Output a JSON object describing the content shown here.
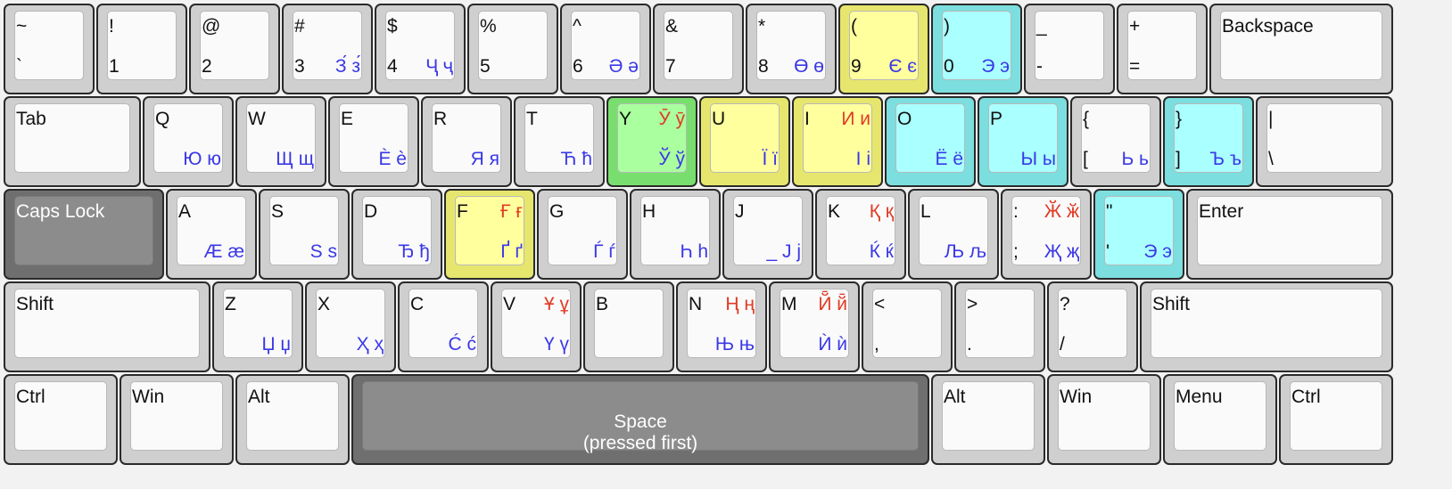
{
  "keys": [
    {
      "row": 0,
      "w": 1,
      "tl": "~",
      "bl": "`"
    },
    {
      "row": 0,
      "w": 1,
      "tl": "!",
      "bl": "1"
    },
    {
      "row": 0,
      "w": 1,
      "tl": "@",
      "bl": "2"
    },
    {
      "row": 0,
      "w": 1,
      "tl": "#",
      "bl": "3",
      "br": "З́ з́"
    },
    {
      "row": 0,
      "w": 1,
      "tl": "$",
      "bl": "4",
      "br": "Ҷ ҷ"
    },
    {
      "row": 0,
      "w": 1,
      "tl": "%",
      "bl": "5"
    },
    {
      "row": 0,
      "w": 1,
      "tl": "^",
      "bl": "6",
      "br": "Ә ә"
    },
    {
      "row": 0,
      "w": 1,
      "tl": "&",
      "bl": "7"
    },
    {
      "row": 0,
      "w": 1,
      "tl": "*",
      "bl": "8",
      "br": "Ө ө"
    },
    {
      "row": 0,
      "w": 1,
      "tl": "(",
      "bl": "9",
      "br": "Є є",
      "color": "yellow"
    },
    {
      "row": 0,
      "w": 1,
      "tl": ")",
      "bl": "0",
      "br": "Э э",
      "color": "cyan"
    },
    {
      "row": 0,
      "w": 1,
      "tl": "_",
      "bl": "-"
    },
    {
      "row": 0,
      "w": 1,
      "tl": "+",
      "bl": "="
    },
    {
      "row": 0,
      "w": 2,
      "tl": "Backspace"
    },
    {
      "row": 1,
      "w": 1.5,
      "tl": "Tab"
    },
    {
      "row": 1,
      "w": 1,
      "tl": "Q",
      "br": "Ю ю"
    },
    {
      "row": 1,
      "w": 1,
      "tl": "W",
      "br": "Щ щ"
    },
    {
      "row": 1,
      "w": 1,
      "tl": "E",
      "br": "È è"
    },
    {
      "row": 1,
      "w": 1,
      "tl": "R",
      "br": "Я я"
    },
    {
      "row": 1,
      "w": 1,
      "tl": "T",
      "br": "Ћ ћ"
    },
    {
      "row": 1,
      "w": 1,
      "tl": "Y",
      "tr": "Ӯ ӯ",
      "br": "Ў ў",
      "color": "green"
    },
    {
      "row": 1,
      "w": 1,
      "tl": "U",
      "br": "Ї ї",
      "color": "yellow"
    },
    {
      "row": 1,
      "w": 1,
      "tl": "I",
      "tr": "И и",
      "br": "І і",
      "color": "yellow"
    },
    {
      "row": 1,
      "w": 1,
      "tl": "O",
      "br": "Ё ё",
      "color": "cyan"
    },
    {
      "row": 1,
      "w": 1,
      "tl": "P",
      "br": "Ы ы",
      "color": "cyan"
    },
    {
      "row": 1,
      "w": 1,
      "tl": "{",
      "bl": "[",
      "br": "Ь ь"
    },
    {
      "row": 1,
      "w": 1,
      "tl": "}",
      "bl": "]",
      "br": "Ъ ъ",
      "color": "cyan"
    },
    {
      "row": 1,
      "w": 1.5,
      "tl": "|",
      "bl": "\\"
    },
    {
      "row": 2,
      "w": 1.75,
      "tl": "Caps Lock",
      "color": "dark"
    },
    {
      "row": 2,
      "w": 1,
      "tl": "A",
      "br": "Æ æ"
    },
    {
      "row": 2,
      "w": 1,
      "tl": "S",
      "br": "Ѕ ѕ"
    },
    {
      "row": 2,
      "w": 1,
      "tl": "D",
      "br": "Ђ ђ"
    },
    {
      "row": 2,
      "w": 1,
      "tl": "F",
      "tr": "Ғ ғ",
      "br": "Ґ ґ",
      "color": "yellow"
    },
    {
      "row": 2,
      "w": 1,
      "tl": "G",
      "br": "Ѓ ѓ"
    },
    {
      "row": 2,
      "w": 1,
      "tl": "H",
      "br": "Һ һ"
    },
    {
      "row": 2,
      "w": 1,
      "tl": "J",
      "br": "_ Ј ј"
    },
    {
      "row": 2,
      "w": 1,
      "tl": "K",
      "tr": "Қ қ",
      "br": "Ќ ќ"
    },
    {
      "row": 2,
      "w": 1,
      "tl": "L",
      "br": "Љ љ"
    },
    {
      "row": 2,
      "w": 1,
      "tl": ":",
      "bl": ";",
      "tr": "Ӂ ӂ",
      "br": "Җ җ"
    },
    {
      "row": 2,
      "w": 1,
      "tl": "\"",
      "bl": "'",
      "br": "Э э",
      "color": "cyan"
    },
    {
      "row": 2,
      "w": 2.25,
      "tl": "Enter"
    },
    {
      "row": 3,
      "w": 2.25,
      "tl": "Shift"
    },
    {
      "row": 3,
      "w": 1,
      "tl": "Z",
      "br": "Џ џ"
    },
    {
      "row": 3,
      "w": 1,
      "tl": "X",
      "br": "Ҳ ҳ"
    },
    {
      "row": 3,
      "w": 1,
      "tl": "C",
      "br": "Ć ć"
    },
    {
      "row": 3,
      "w": 1,
      "tl": "V",
      "tr": "Ұ ұ",
      "br": "Ү ү"
    },
    {
      "row": 3,
      "w": 1,
      "tl": "B"
    },
    {
      "row": 3,
      "w": 1,
      "tl": "N",
      "tr": "Ң ң",
      "br": "Њ њ"
    },
    {
      "row": 3,
      "w": 1,
      "tl": "M",
      "tr": "Й̄ й̄",
      "br": "Ѝ ѝ"
    },
    {
      "row": 3,
      "w": 1,
      "tl": "<",
      "bl": ","
    },
    {
      "row": 3,
      "w": 1,
      "tl": ">",
      "bl": "."
    },
    {
      "row": 3,
      "w": 1,
      "tl": "?",
      "bl": "/"
    },
    {
      "row": 3,
      "w": 2.75,
      "tl": "Shift"
    },
    {
      "row": 4,
      "w": 1.25,
      "tl": "Ctrl"
    },
    {
      "row": 4,
      "w": 1.25,
      "tl": "Win"
    },
    {
      "row": 4,
      "w": 1.25,
      "tl": "Alt"
    },
    {
      "row": 4,
      "w": 6.25,
      "center": "Space\n(pressed first)",
      "color": "dark"
    },
    {
      "row": 4,
      "w": 1.25,
      "tl": "Alt"
    },
    {
      "row": 4,
      "w": 1.25,
      "tl": "Win"
    },
    {
      "row": 4,
      "w": 1.25,
      "tl": "Menu"
    },
    {
      "row": 4,
      "w": 1.25,
      "tl": "Ctrl"
    }
  ]
}
